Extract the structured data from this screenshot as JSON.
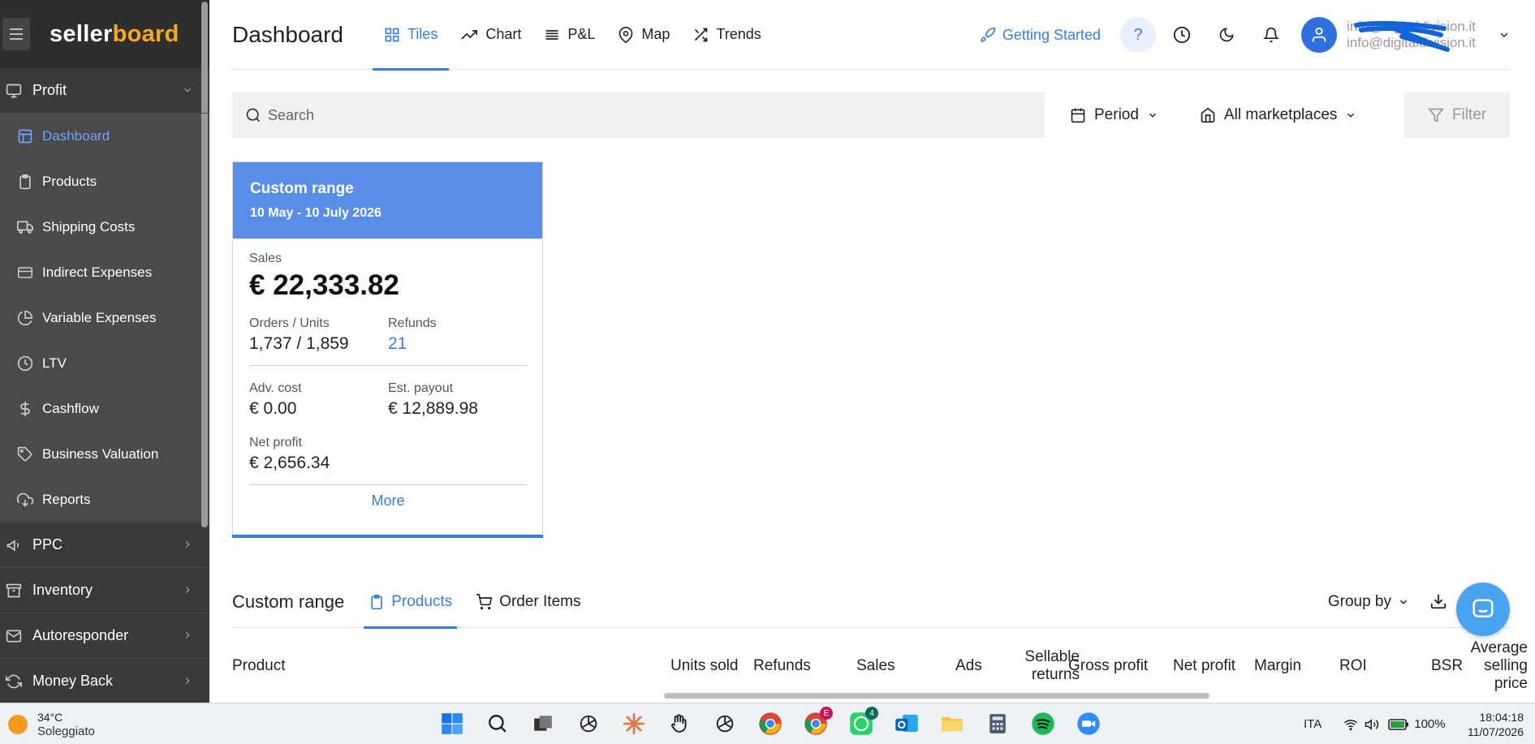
{
  "app": {
    "logo_part1": "seller",
    "logo_part2": "board"
  },
  "sidebar": {
    "profit": {
      "label": "Profit"
    },
    "items": [
      {
        "label": "Dashboard",
        "icon": "layout-icon",
        "active": true
      },
      {
        "label": "Products",
        "icon": "clipboard-icon"
      },
      {
        "label": "Shipping Costs",
        "icon": "truck-icon"
      },
      {
        "label": "Indirect Expenses",
        "icon": "card-icon"
      },
      {
        "label": "Variable Expenses",
        "icon": "pie-icon"
      },
      {
        "label": "LTV",
        "icon": "clock-icon"
      },
      {
        "label": "Cashflow",
        "icon": "dollar-icon"
      },
      {
        "label": "Business Valuation",
        "icon": "tag-icon"
      },
      {
        "label": "Reports",
        "icon": "cloud-download-icon"
      }
    ],
    "sections": [
      {
        "label": "PPC",
        "icon": "megaphone-icon"
      },
      {
        "label": "Inventory",
        "icon": "archive-icon"
      },
      {
        "label": "Autoresponder",
        "icon": "mail-icon"
      },
      {
        "label": "Money Back",
        "icon": "refresh-icon"
      }
    ]
  },
  "header": {
    "title": "Dashboard",
    "tabs": [
      {
        "label": "Tiles",
        "icon": "grid-icon",
        "active": true
      },
      {
        "label": "Chart",
        "icon": "trending-icon"
      },
      {
        "label": "P&L",
        "icon": "list-icon"
      },
      {
        "label": "Map",
        "icon": "map-pin-icon"
      },
      {
        "label": "Trends",
        "icon": "shuffle-icon"
      }
    ],
    "getting_started": "Getting Started",
    "help": "?",
    "email_line1": "info@digitaldivision.it",
    "email_line2": "info@digitaldivision.it"
  },
  "filters": {
    "search_placeholder": "Search",
    "period": "Period",
    "marketplaces": "All marketplaces",
    "filter": "Filter"
  },
  "tile": {
    "title": "Custom range",
    "date_range": "10 May - 10 July 2026",
    "sales_label": "Sales",
    "sales_value": "€ 22,333.82",
    "orders_label": "Orders / Units",
    "orders_value": "1,737 / 1,859",
    "refunds_label": "Refunds",
    "refunds_value": "21",
    "adv_label": "Adv. cost",
    "adv_value": "€ 0.00",
    "payout_label": "Est. payout",
    "payout_value": "€ 12,889.98",
    "net_label": "Net profit",
    "net_value": "€ 2,656.34",
    "more": "More"
  },
  "lower": {
    "title": "Custom range",
    "tabs": [
      {
        "label": "Products",
        "active": true
      },
      {
        "label": "Order Items"
      }
    ],
    "group_by": "Group by",
    "columns": [
      "Product",
      "Units sold",
      "Refunds",
      "Sales",
      "Ads",
      "Sellable returns",
      "Gross profit",
      "Net profit",
      "Margin",
      "ROI",
      "BSR",
      "Average selling price"
    ]
  },
  "taskbar": {
    "temp": "34°C",
    "weather": "Soleggiato",
    "lang": "ITA",
    "battery": "100%",
    "time": "18:04:18",
    "date": "11/07/2026",
    "badge_chrome": "E",
    "badge_whatsapp": "4"
  },
  "colors": {
    "accent": "#3b7ddd",
    "sidebar": "#3a3a3a",
    "tile_header": "#5a8ee6",
    "logo_accent": "#f5a623"
  }
}
